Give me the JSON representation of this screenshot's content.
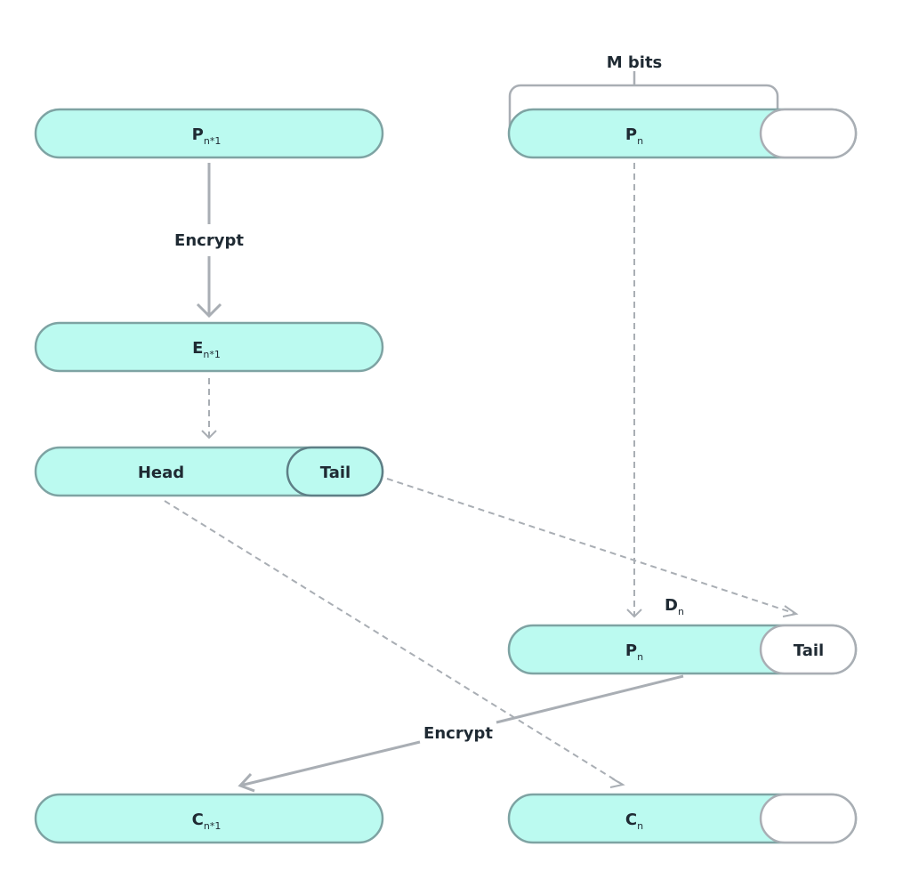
{
  "blocks": {
    "p_prev": {
      "main": "P",
      "sub": "n*1"
    },
    "e_prev": {
      "main": "E",
      "sub": "n*1"
    },
    "head": "Head",
    "tail": "Tail",
    "p_n": {
      "main": "P",
      "sub": "n"
    },
    "d_n": {
      "main": "D",
      "sub": "n"
    },
    "d_pn": {
      "main": "P",
      "sub": "n"
    },
    "d_tail": "Tail",
    "c_prev": {
      "main": "C",
      "sub": "n*1"
    },
    "c_n": {
      "main": "C",
      "sub": "n"
    }
  },
  "labels": {
    "m_bits": "M bits",
    "encrypt_1": "Encrypt",
    "encrypt_2": "Encrypt"
  },
  "colors": {
    "block_fill": "#bbfaf0",
    "block_stroke": "#7ea3a3",
    "arrow": "#a9aeb4",
    "text": "#1f2a33"
  }
}
